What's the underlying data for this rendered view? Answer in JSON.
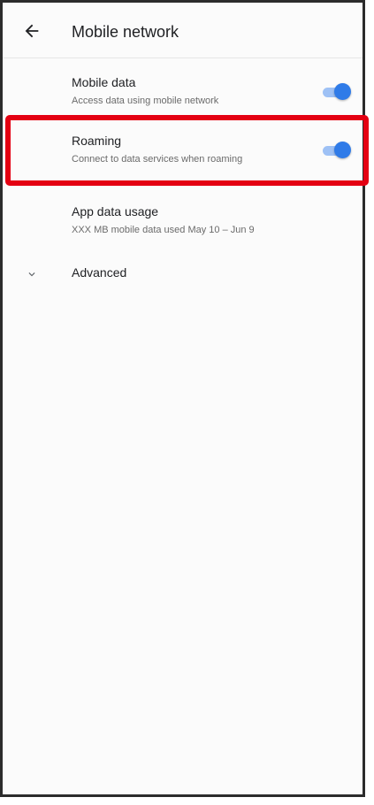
{
  "header": {
    "title": "Mobile network",
    "back_icon": "arrow-left-icon"
  },
  "settings": [
    {
      "title": "Mobile data",
      "subtitle": "Access data using mobile network",
      "toggle_on": true
    },
    {
      "title": "Roaming",
      "subtitle": "Connect to data services when roaming",
      "toggle_on": true
    },
    {
      "title": "App data usage",
      "subtitle": "XXX MB mobile data used May 10 – Jun 9"
    }
  ],
  "advanced": {
    "label": "Advanced",
    "icon": "chevron-down-icon"
  },
  "colors": {
    "toggle_on": "#2f7be8",
    "toggle_track": "#9ec1f5",
    "highlight": "#e40012"
  }
}
